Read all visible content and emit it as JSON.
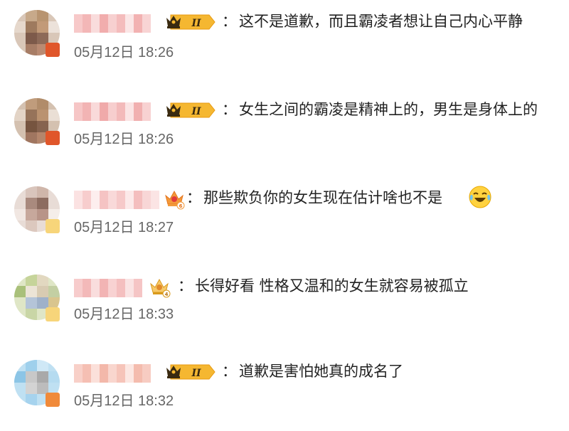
{
  "comments": [
    {
      "text": "这不是道歉，而且霸凌者想让自己内心平静",
      "time": "05月12日 18:26",
      "vip_level": "II"
    },
    {
      "text": "女生之间的霸凌是精神上的，男生是身体上的",
      "time": "05月12日 18:26",
      "vip_level": "II"
    },
    {
      "text": "那些欺负你的女生现在估计啥也不是",
      "time": "05月12日 18:27",
      "vip_level": "6"
    },
    {
      "text": "长得好看 性格又温和的女生就容易被孤立",
      "time": "05月12日 18:33",
      "vip_level": "4"
    },
    {
      "text": "道歉是害怕她真的成名了",
      "time": "05月12日 18:32",
      "vip_level": "II"
    }
  ],
  "colon": "：",
  "colors": {
    "timestamp": "#666666",
    "text": "#222222",
    "vip_gold": "#f5b731",
    "vip_dark": "#3a2a10"
  }
}
